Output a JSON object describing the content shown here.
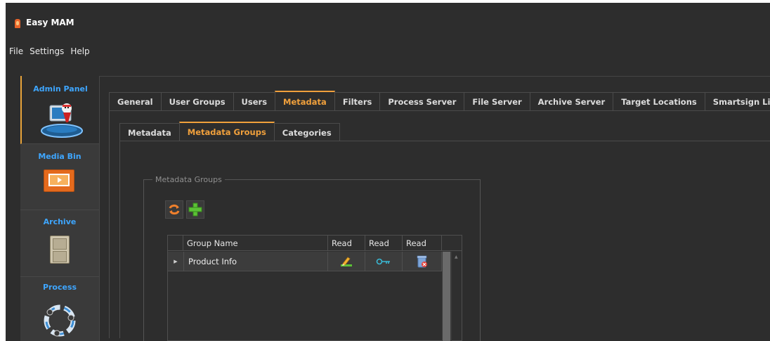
{
  "app": {
    "title": "Easy MAM"
  },
  "menu": [
    "File",
    "Settings",
    "Help"
  ],
  "sidebar": [
    {
      "label": "Admin Panel",
      "icon": "admin-panel-icon"
    },
    {
      "label": "Media Bin",
      "icon": "media-bin-icon"
    },
    {
      "label": "Archive",
      "icon": "archive-cabinet-icon"
    },
    {
      "label": "Process",
      "icon": "process-cycle-icon"
    }
  ],
  "main_tabs": [
    "General",
    "User Groups",
    "Users",
    "Metadata",
    "Filters",
    "Process Server",
    "File Server",
    "Archive Server",
    "Target Locations",
    "Smartsign List"
  ],
  "main_tab_selected": "Metadata",
  "sub_tabs": [
    "Metadata",
    "Metadata Groups",
    "Categories"
  ],
  "sub_tab_selected": "Metadata Groups",
  "groupbox": {
    "title": "Metadata Groups"
  },
  "toolbar": {
    "refresh_icon": "refresh-icon",
    "add_icon": "add-icon"
  },
  "grid": {
    "columns": [
      "Group Name",
      "Read",
      "Read",
      "Read"
    ],
    "rows": [
      {
        "name": "Product Info",
        "icons": [
          "edit-icon",
          "key-icon",
          "delete-icon"
        ]
      }
    ]
  },
  "colors": {
    "accent": "#f0a03c",
    "sidebar_label": "#3ea6ff",
    "background": "#2d2d2d"
  }
}
